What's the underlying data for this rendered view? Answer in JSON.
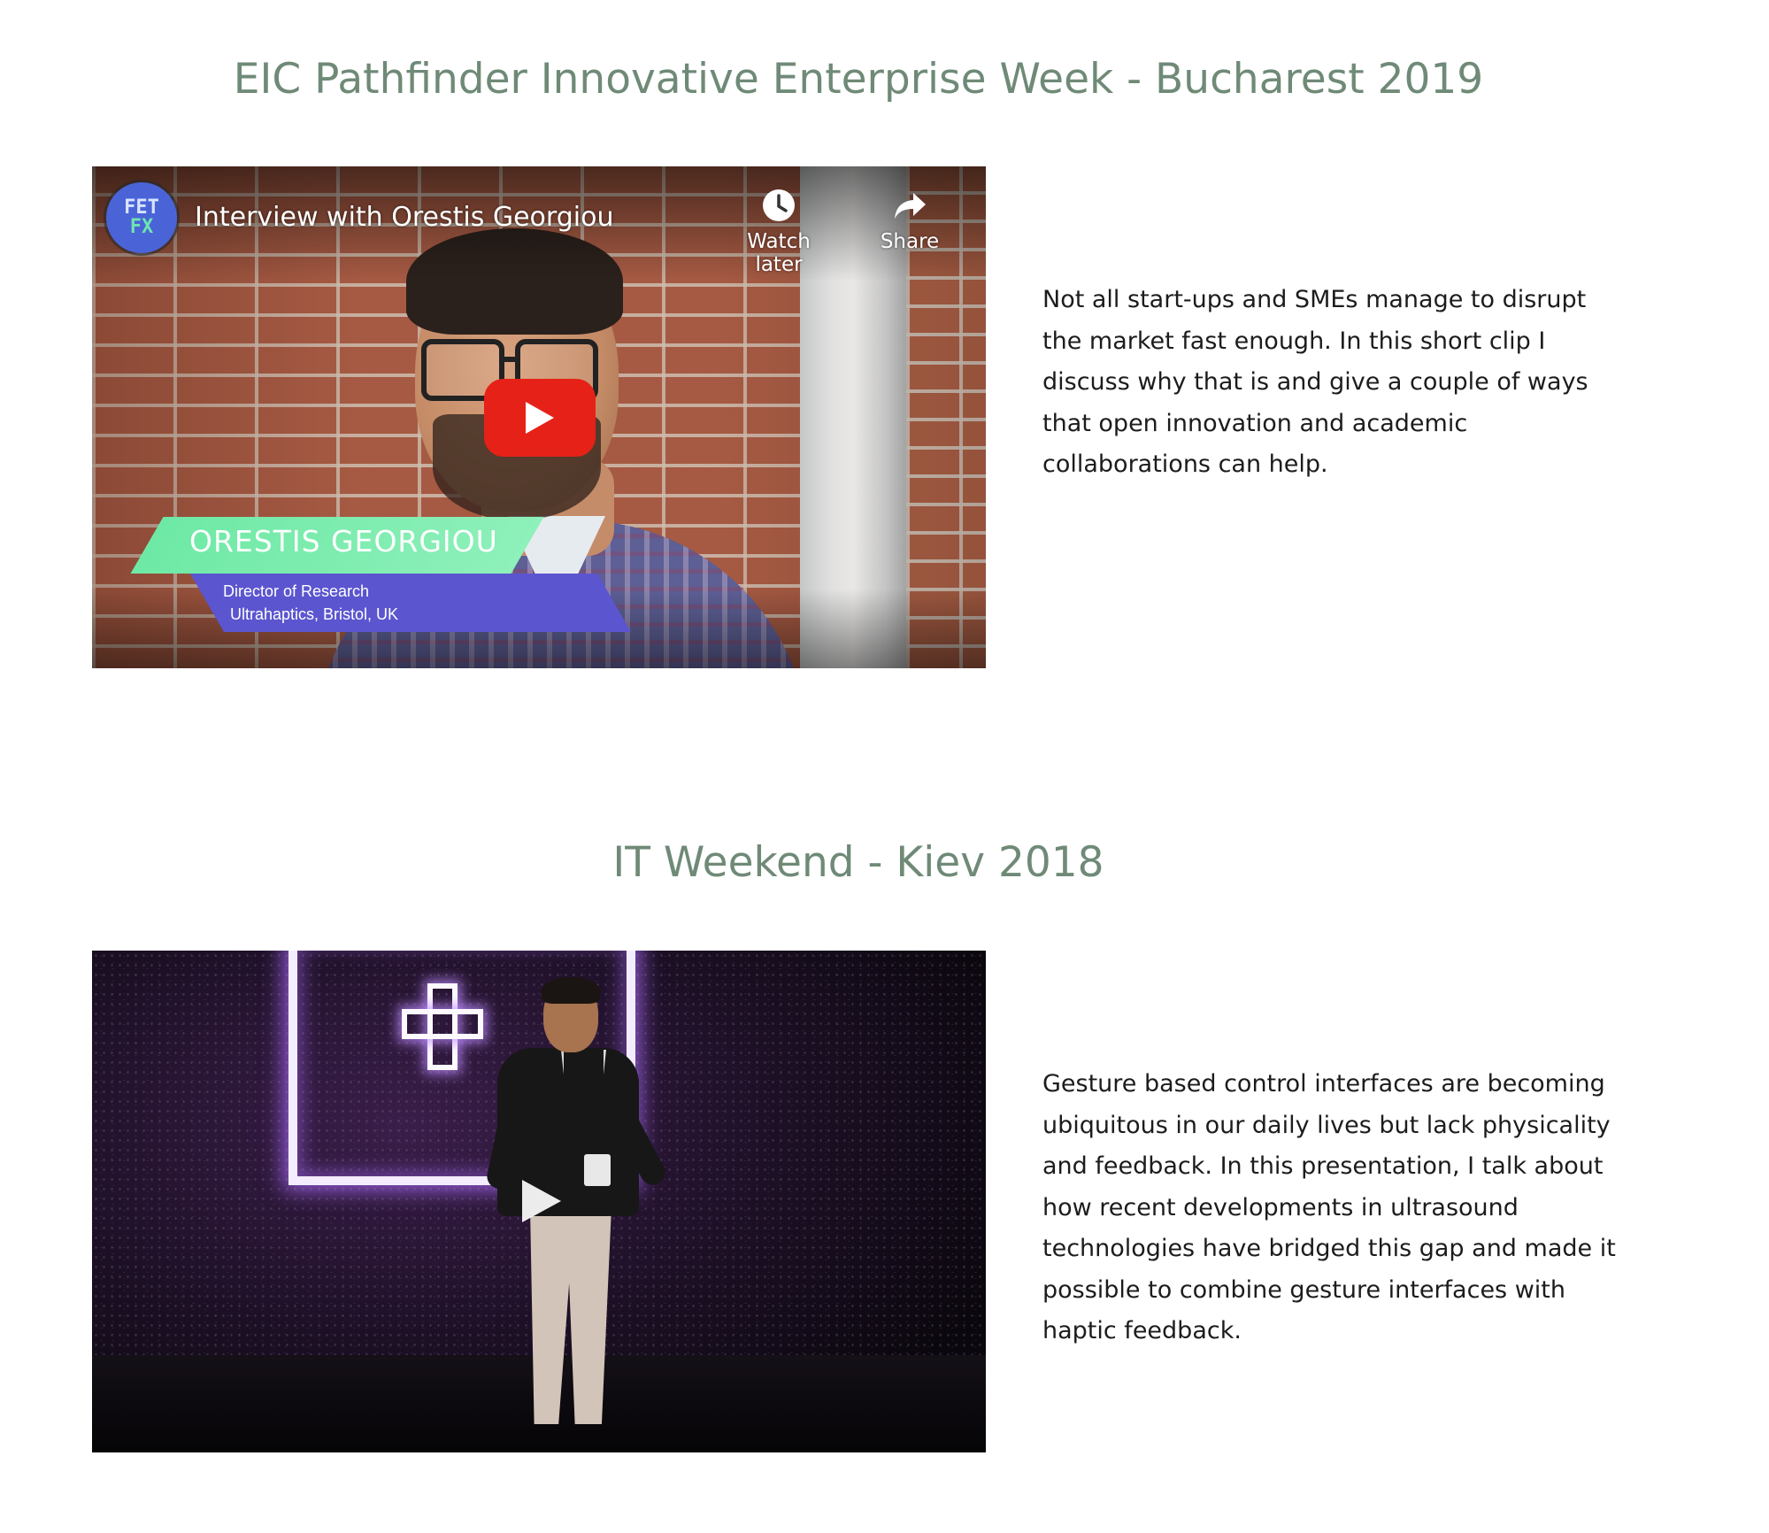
{
  "sections": [
    {
      "title": "EIC Pathfinder Innovative Enterprise Week - Bucharest 2019",
      "video": {
        "channel_logo_top": "FET",
        "channel_logo_bottom": "FX",
        "title": "Interview with Orestis Georgiou",
        "watch_later_label": "Watch later",
        "share_label": "Share",
        "lower_third_name": "ORESTIS GEORGIOU",
        "lower_third_role": "Director of Research",
        "lower_third_org": "Ultrahaptics, Bristol, UK",
        "play_button_color": "#e62117"
      },
      "description": "Not all start-ups and SMEs manage to disrupt the market fast enough. In this short clip I discuss why that is and give a couple of ways that open innovation and academic collaborations can help."
    },
    {
      "title": "IT Weekend - Kiev 2018",
      "video": {
        "play_icon": "play-triangle-icon"
      },
      "description": "Gesture based control interfaces are becoming ubiquitous in our daily lives but lack physicality and feedback. In this  presentation, I talk about how recent developments in ultrasound technologies have bridged this gap and made it possible to combine gesture interfaces with haptic feedback."
    }
  ],
  "colors": {
    "heading": "#6f8a77",
    "body_text": "#1c1c1c",
    "background": "#ffffff",
    "lower_third_green": "#6ee9a5",
    "lower_third_blue": "#5b55cf"
  }
}
